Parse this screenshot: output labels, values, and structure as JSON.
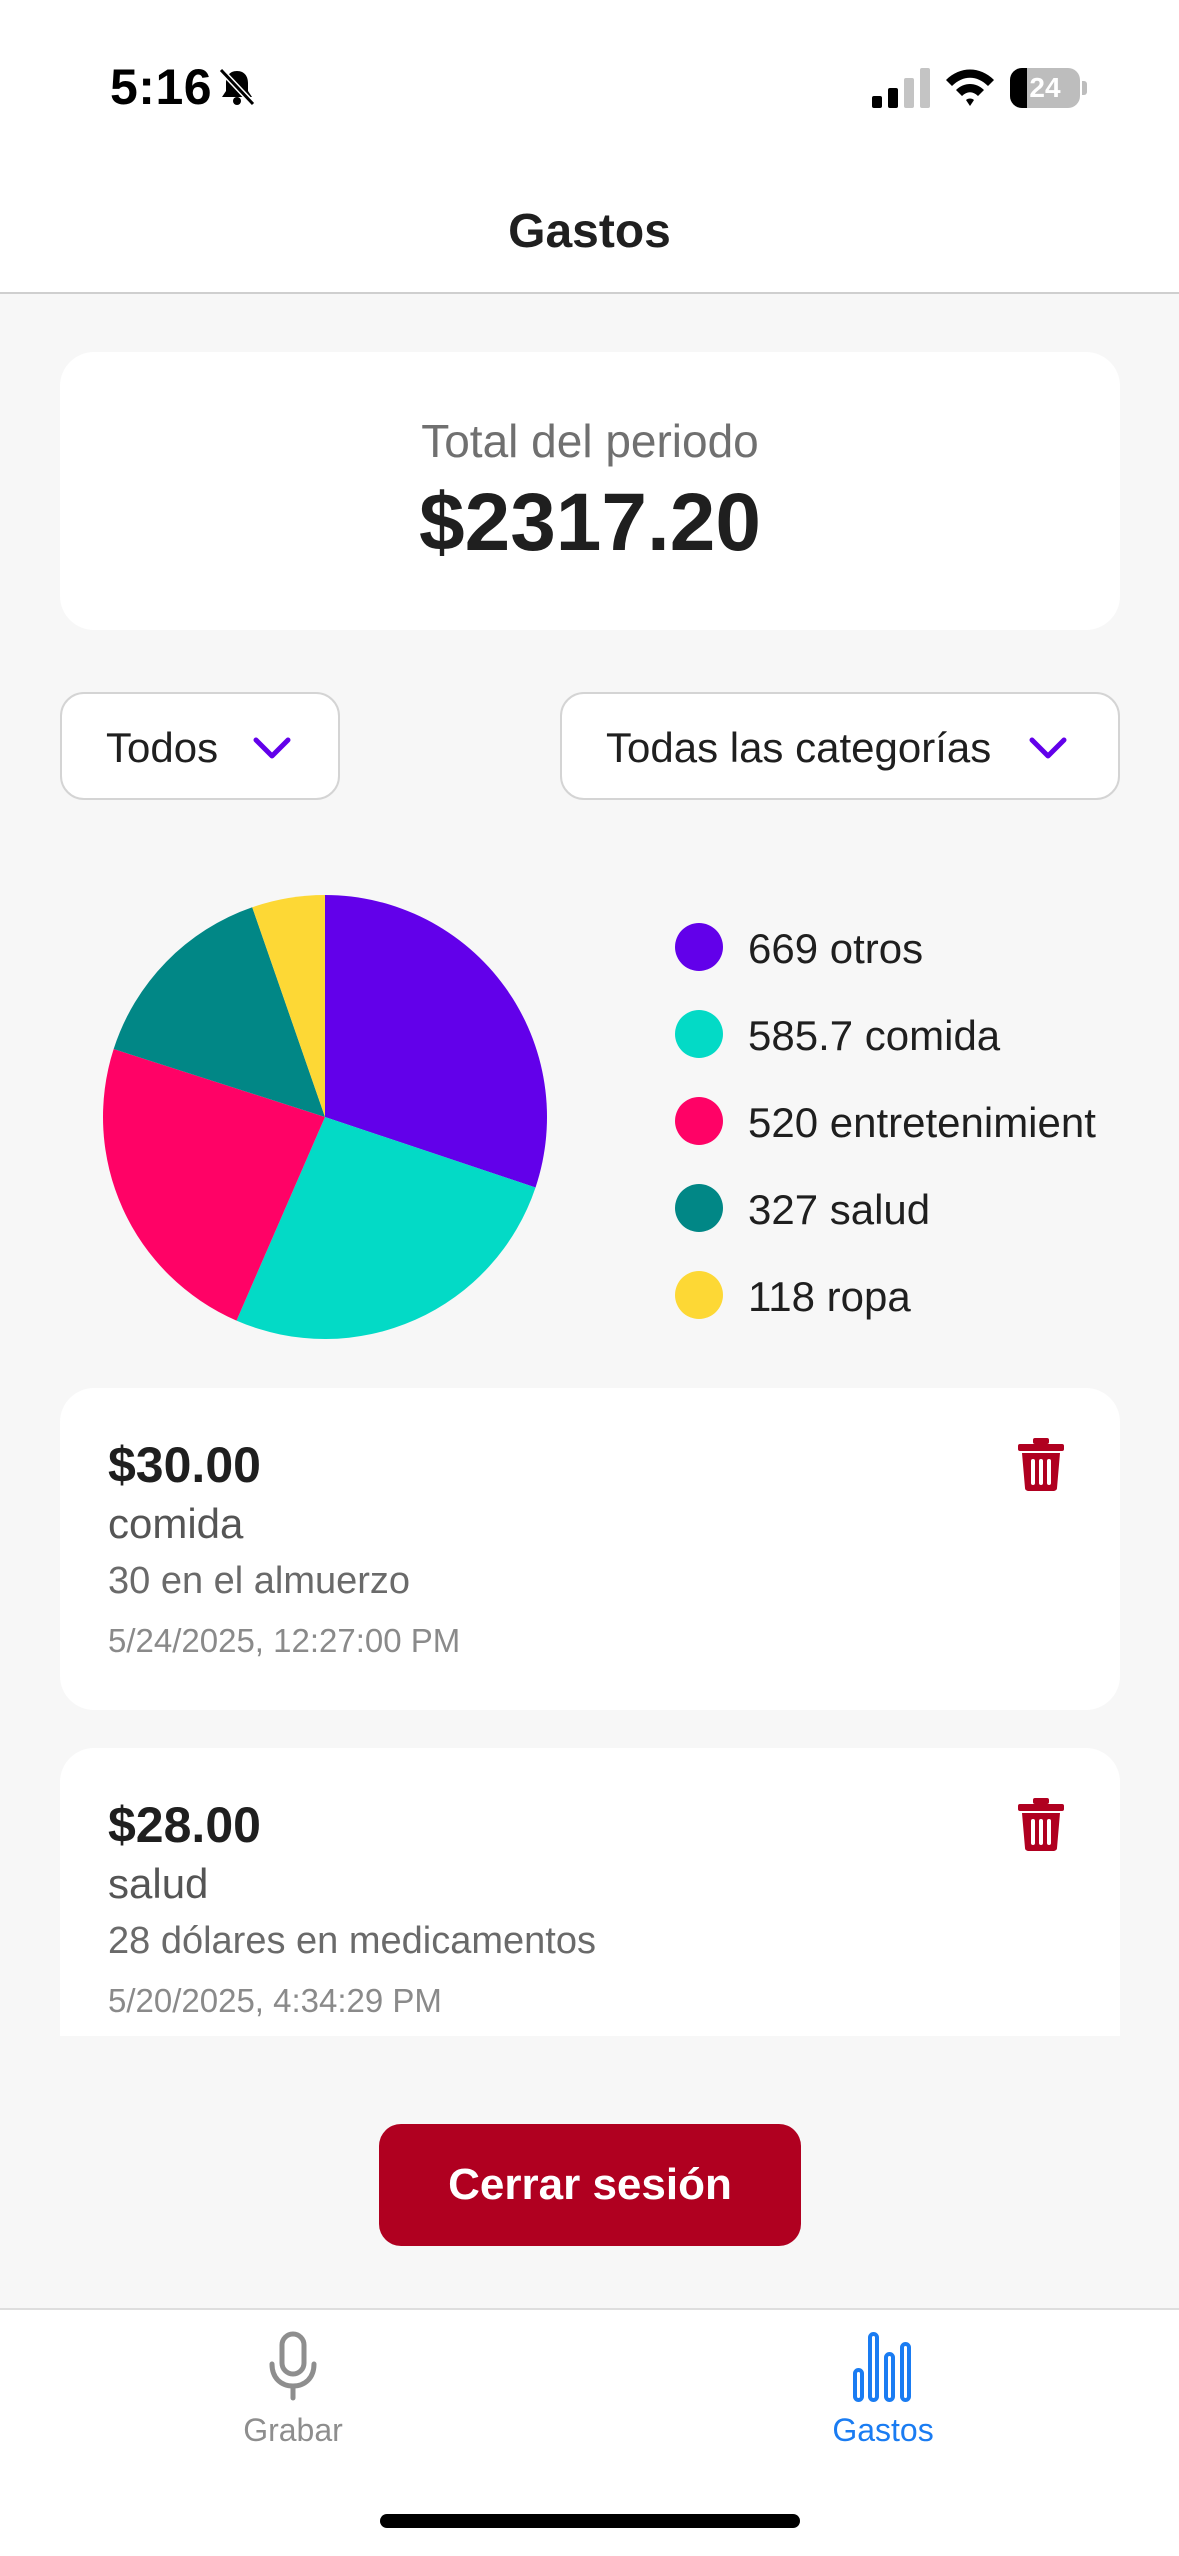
{
  "status_bar": {
    "time": "5:16",
    "battery_level": "24",
    "battery_fraction": 0.24
  },
  "header": {
    "title": "Gastos"
  },
  "summary": {
    "label": "Total del periodo",
    "total": "$2317.20"
  },
  "filters": {
    "period": {
      "selected": "Todos"
    },
    "category": {
      "selected": "Todas las categorías"
    }
  },
  "chart_data": {
    "type": "pie",
    "categories": [
      "otros",
      "comida",
      "entretenimient",
      "salud",
      "ropa"
    ],
    "values": [
      669,
      585.7,
      520,
      327,
      118
    ],
    "colors": [
      "#6200ea",
      "#03dac6",
      "#ff0266",
      "#018786",
      "#fdd835"
    ],
    "legend": [
      {
        "label": "669 otros",
        "color": "#6200ea"
      },
      {
        "label": "585.7 comida",
        "color": "#03dac6"
      },
      {
        "label": "520 entretenimient",
        "color": "#ff0266"
      },
      {
        "label": "327 salud",
        "color": "#018786"
      },
      {
        "label": "118 ropa",
        "color": "#fdd835"
      }
    ],
    "legend_placement": "right"
  },
  "expenses": [
    {
      "amount": "$30.00",
      "category": "comida",
      "description": "30 en el almuerzo",
      "date": "5/24/2025, 12:27:00 PM"
    },
    {
      "amount": "$28.00",
      "category": "salud",
      "description": "28 dólares en medicamentos",
      "date": "5/20/2025, 4:34:29 PM"
    }
  ],
  "logout": {
    "label": "Cerrar sesión"
  },
  "tabs": [
    {
      "label": "Grabar",
      "icon": "microphone-icon",
      "active": false
    },
    {
      "label": "Gastos",
      "icon": "bar-chart-icon",
      "active": true
    }
  ],
  "colors": {
    "accent": "#6200ea",
    "danger": "#b00020",
    "tab_active": "#1a7cf2",
    "tab_inactive": "#8e8e8e"
  }
}
